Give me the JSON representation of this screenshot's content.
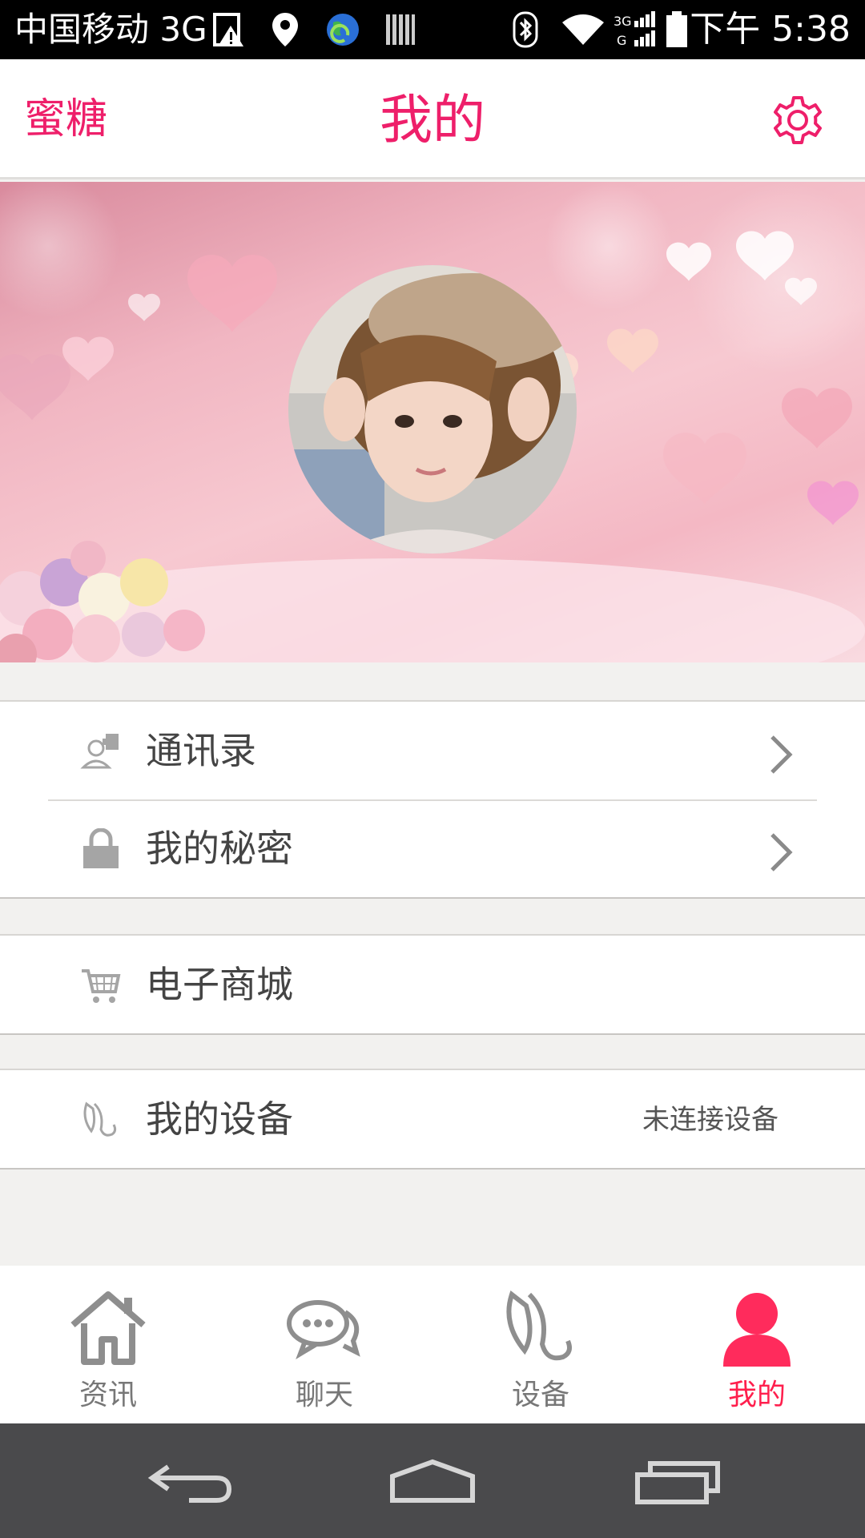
{
  "status_bar": {
    "carrier": "中国移动 3G",
    "clock": "下午 5:38",
    "icons": [
      "warning-icon",
      "location-icon",
      "globe-sync-icon",
      "barcode-icon",
      "bluetooth-icon",
      "wifi-icon",
      "signal-icon",
      "battery-icon"
    ]
  },
  "header": {
    "back_label": "蜜糖",
    "title": "我的",
    "settings_icon": "gear-icon",
    "accent_color": "#ee1f6a"
  },
  "menu": {
    "group1": [
      {
        "label": "通讯录",
        "icon": "contacts-icon"
      },
      {
        "label": "我的秘密",
        "icon": "lock-icon"
      }
    ],
    "group2": [
      {
        "label": "电子商城",
        "icon": "cart-icon"
      }
    ],
    "group3": [
      {
        "label": "我的设备",
        "icon": "device-icon",
        "status": "未连接设备"
      }
    ]
  },
  "tabs": [
    {
      "label": "资讯",
      "icon": "home-icon"
    },
    {
      "label": "聊天",
      "icon": "chat-icon"
    },
    {
      "label": "设备",
      "icon": "device-icon"
    },
    {
      "label": "我的",
      "icon": "person-icon",
      "active": true,
      "color": "#ff1f4d"
    }
  ],
  "nav_bar": [
    "back-icon",
    "home-icon",
    "recents-icon"
  ]
}
